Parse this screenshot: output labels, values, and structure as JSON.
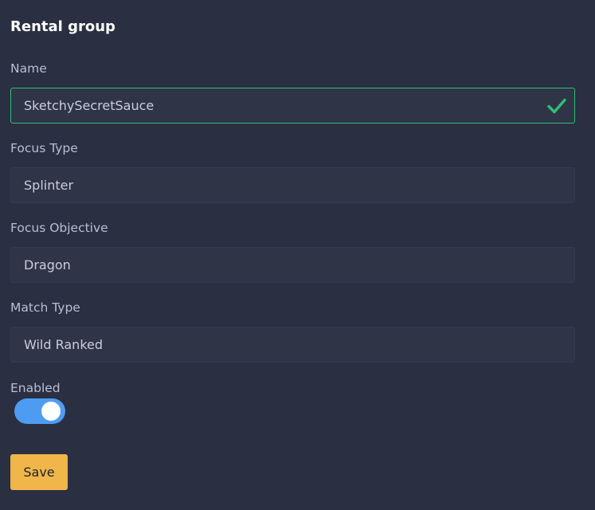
{
  "form": {
    "title": "Rental group",
    "name": {
      "label": "Name",
      "value": "SketchySecretSauce",
      "valid_icon": "check-icon",
      "valid_color": "#2fbf78"
    },
    "focus_type": {
      "label": "Focus Type",
      "value": "Splinter"
    },
    "focus_objective": {
      "label": "Focus Objective",
      "value": "Dragon"
    },
    "match_type": {
      "label": "Match Type",
      "value": "Wild Ranked"
    },
    "enabled": {
      "label": "Enabled",
      "checked": true,
      "on_color": "#4e9cf2"
    },
    "save_label": "Save",
    "save_color": "#f0b64a"
  }
}
